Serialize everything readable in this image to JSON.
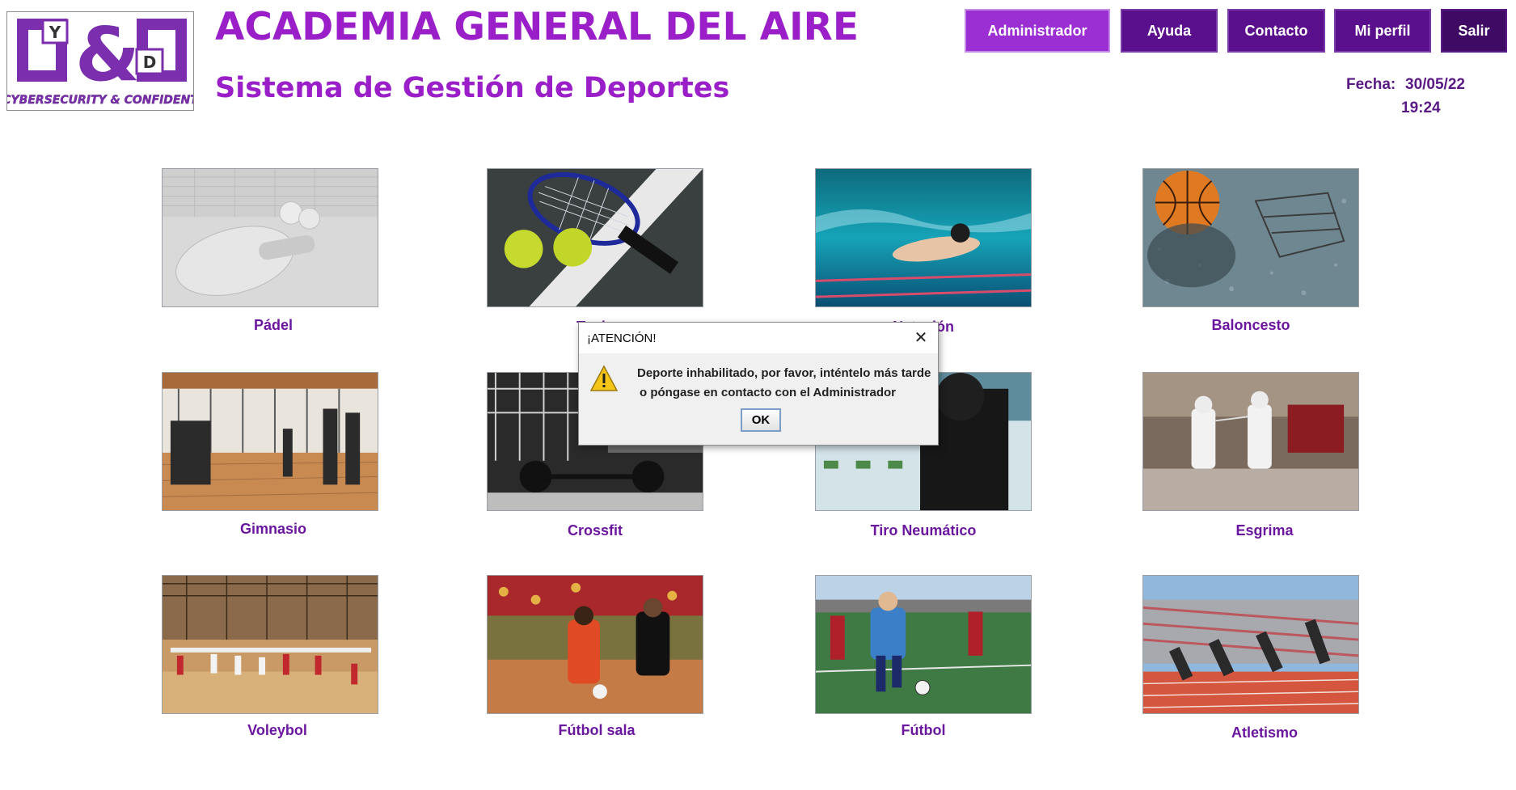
{
  "logo": {
    "top_text": "Y",
    "right_text": "D",
    "ampersand": "&",
    "caption": "CYBERSECURITY & CONFIDENT",
    "color": "#7b2fae"
  },
  "header": {
    "title": "ACADEMIA GENERAL DEL AIRE",
    "subtitle": "Sistema de Gestión de Deportes"
  },
  "nav": {
    "admin": "Administrador",
    "ayuda": "Ayuda",
    "contacto": "Contacto",
    "perfil": "Mi perfil",
    "salir": "Salir"
  },
  "datetime": {
    "label": "Fecha:",
    "date": "30/05/22",
    "time": "19:24"
  },
  "sports": [
    {
      "label": "Pádel",
      "icon": "padel-image"
    },
    {
      "label": "Tenis",
      "icon": "tennis-image"
    },
    {
      "label": "Natación",
      "icon": "swimming-image"
    },
    {
      "label": "Baloncesto",
      "icon": "basketball-image"
    },
    {
      "label": "Gimnasio",
      "icon": "gym-image"
    },
    {
      "label": "Crossfit",
      "icon": "crossfit-image"
    },
    {
      "label": "Tiro Neumático",
      "icon": "shooting-image"
    },
    {
      "label": "Esgrima",
      "icon": "fencing-image"
    },
    {
      "label": "Voleybol",
      "icon": "volleyball-image"
    },
    {
      "label": "Fútbol sala",
      "icon": "futsal-image"
    },
    {
      "label": "Fútbol",
      "icon": "football-image"
    },
    {
      "label": "Atletismo",
      "icon": "athletics-image"
    }
  ],
  "dialog": {
    "title": "¡ATENCIÓN!",
    "line1": "Deporte inhabilitado, por favor, inténtelo más tarde",
    "line2": "o póngase en contacto con el Administrador",
    "ok": "OK",
    "close": "✕",
    "icon": "warning-icon"
  },
  "colors": {
    "brand_purple": "#9a1fc8",
    "nav_active": "#9b2fd4",
    "nav_dark": "#5a0f8c",
    "nav_darkest": "#3f0a64",
    "label_purple": "#6b169e"
  }
}
